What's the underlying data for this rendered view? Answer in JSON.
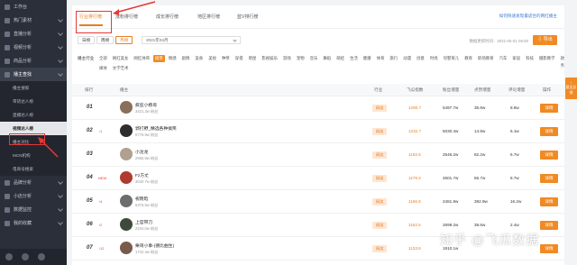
{
  "sidebar": {
    "items": [
      {
        "label": "工作台",
        "chev": false,
        "open": false
      },
      {
        "label": "热门素材",
        "chev": true,
        "open": false
      },
      {
        "label": "直播分析",
        "chev": true,
        "open": false
      },
      {
        "label": "视频分析",
        "chev": true,
        "open": false
      },
      {
        "label": "商品分析",
        "chev": true,
        "open": false
      },
      {
        "label": "播主查找",
        "chev": true,
        "open": true
      }
    ],
    "sub": [
      {
        "label": "播主搜索",
        "active": false
      },
      {
        "label": "带货达人榜",
        "active": false
      },
      {
        "label": "直播达人榜",
        "active": false
      },
      {
        "label": "视频达人榜",
        "active": true
      },
      {
        "label": "播主对比",
        "active": false
      },
      {
        "label": "MCN机构",
        "active": false
      },
      {
        "label": "电商号搜索",
        "active": false
      }
    ],
    "items2": [
      {
        "label": "品牌分析"
      },
      {
        "label": "小店分析"
      },
      {
        "label": "数据监控"
      },
      {
        "label": "我的收藏"
      }
    ]
  },
  "tabs": [
    "行业排行榜",
    "涨粉排行榜",
    "成长排行榜",
    "地区排行榜",
    "蓝V排行榜"
  ],
  "help_text": "如何快速发现最适合的网红播主",
  "toolbar": {
    "periods": [
      "日榜",
      "周榜",
      "月榜"
    ],
    "active_period": "月榜",
    "date_value": "2021年04月",
    "update_text": "数据更新时间：2021-05-01 06:00",
    "export_label": "导出"
  },
  "filters": {
    "row1_label": "播主行业",
    "row1": [
      "全部",
      "网红美女",
      "网红帅哥",
      "搞笑",
      "情感",
      "剧情",
      "美食",
      "美妆",
      "种草",
      "穿搭",
      "明星",
      "影视娱乐",
      "游戏",
      "宠物",
      "音乐",
      "舞蹈",
      "萌娃",
      "生活",
      "健康",
      "体育",
      "旅行",
      "动漫",
      "创意",
      "时尚",
      "母婴育儿",
      "教育",
      "职场教育",
      "汽车",
      "家居",
      "科技",
      "摄影教学",
      "政务"
    ],
    "row1_active": "搞笑",
    "row2": [
      "媒体",
      "文学艺术"
    ]
  },
  "table": {
    "headers": [
      "排行",
      "播主",
      "行业",
      "飞瓜指数",
      "粉丝增量",
      "点赞增量",
      "评论增量",
      "操作"
    ],
    "rows": [
      {
        "rank": "01",
        "change": "",
        "name": "疯狂小杨哥",
        "fans": "3421.3w 粉丝",
        "cat": "搞笑",
        "score": "1290.7",
        "fan_inc": "5497.7w",
        "likes": "35.8w",
        "comments": "8.8w",
        "avatar": "#8a6f5a"
      },
      {
        "rank": "02",
        "change": "↓1",
        "name": "郭打野_精选各种搞笑",
        "fans": "5776.9w 粉丝",
        "cat": "搞笑",
        "score": "1232.7",
        "fan_inc": "5030.4w",
        "likes": "14.8w",
        "comments": "6.1w",
        "avatar": "#2e2e2e"
      },
      {
        "rank": "03",
        "change": "",
        "name": "小沈龙",
        "fans": "2955.9w 粉丝",
        "cat": "搞笑",
        "score": "1192.6",
        "fan_inc": "2546.2w",
        "likes": "82.2w",
        "comments": "6.7w",
        "avatar": "#b0a090"
      },
      {
        "rank": "04",
        "change": "NEW",
        "name": "Fz方丈",
        "fans": "3040.7w 粉丝",
        "cat": "搞笑",
        "score": "1179.3",
        "fan_inc": "2601.7w",
        "likes": "56.7w",
        "comments": "8.7w",
        "avatar": "#b03a2e"
      },
      {
        "rank": "05",
        "change": "↑4",
        "name": "祝晓晗",
        "fans": "5376.5w 粉丝",
        "cat": "搞笑",
        "score": "1166.8",
        "fan_inc": "2481.9w",
        "likes": "392.9w",
        "comments": "16.2w",
        "avatar": "#6d6d6d"
      },
      {
        "rank": "06",
        "change": "↑2",
        "name": "上官带刀",
        "fans": "2104.0w 粉丝",
        "cat": "搞笑",
        "score": "1152.5",
        "fan_inc": "2699.2w",
        "likes": "38.6w",
        "comments": "2.4w",
        "avatar": "#3f4a3c"
      },
      {
        "rank": "07",
        "change": "↑12",
        "name": "栗哥小事-(德比曲生)",
        "fans": "1742.4w 粉丝",
        "cat": "搞笑",
        "score": "1133.8",
        "fan_inc": "1910.1w",
        "likes": "",
        "comments": "",
        "avatar": "#7a5a4a"
      }
    ],
    "detail_label": "详情"
  },
  "side_tab": "意见反馈",
  "watermark": "知乎 @飞瓜数据"
}
